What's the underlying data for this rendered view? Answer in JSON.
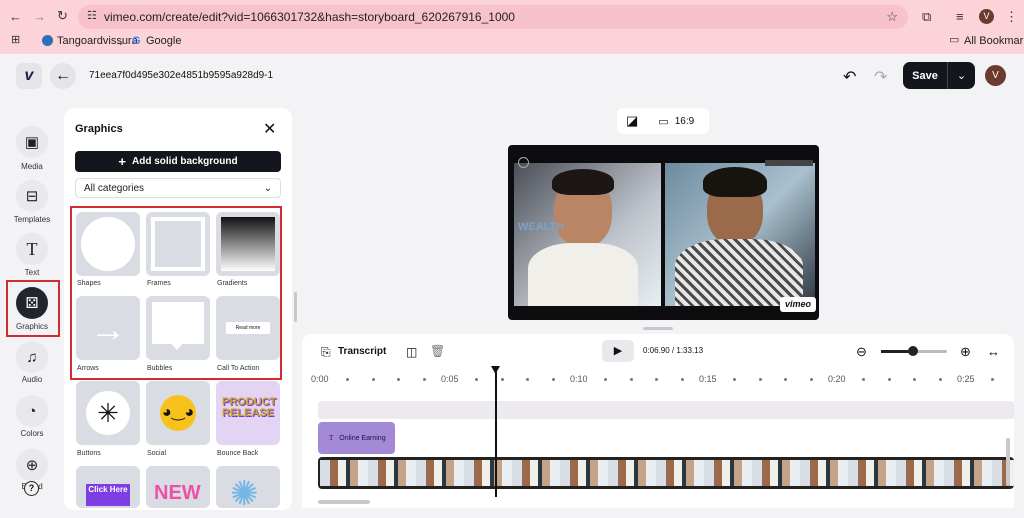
{
  "browser": {
    "url": "vimeo.com/create/edit?vid=1066301732&hash=storyboard_620267916_1000",
    "avatar_letter": "V",
    "bookmarks": [
      "Tangoardvissura",
      "Google"
    ],
    "all_bookmarks": "All Bookmarks"
  },
  "header": {
    "logo": "v",
    "project_id": "71eea7f0d495e302e4851b9595a928d9-1",
    "save_label": "Save",
    "user_initial": "V"
  },
  "sidebar": {
    "items": [
      {
        "label": "Media",
        "icon": "image-icon"
      },
      {
        "label": "Templates",
        "icon": "templates-icon"
      },
      {
        "label": "Text",
        "icon": "text-icon"
      },
      {
        "label": "Graphics",
        "icon": "graphics-icon",
        "active": true
      },
      {
        "label": "Audio",
        "icon": "music-icon"
      },
      {
        "label": "Colors",
        "icon": "palette-icon"
      },
      {
        "label": "Brand",
        "icon": "brand-icon"
      }
    ]
  },
  "graphics_panel": {
    "title": "Graphics",
    "add_bg": "Add solid background",
    "category": "All categories",
    "cards": [
      "Shapes",
      "Frames",
      "Gradients",
      "Arrows",
      "Bubbles",
      "Call To Action",
      "Buttons",
      "Social",
      "Bounce Back"
    ],
    "cta_text": "Read more",
    "bounce_text": "PRODUCT RELEASE",
    "bottom_cards": [
      "Click Here",
      "NEW"
    ]
  },
  "canvas": {
    "aspect": "16:9",
    "watermark": "vimeo",
    "video_tag": "WEALTH"
  },
  "timeline": {
    "transcript_label": "Transcript",
    "current_time": "0:06.90",
    "separator": " / ",
    "total_time": "1:33.13",
    "ticks": [
      "0:00",
      "0:05",
      "0:10",
      "0:15",
      "0:20",
      "0:25"
    ],
    "text_clip": "Online Earning"
  },
  "colors": {
    "chrome": "#fbd3d9",
    "accent_purple": "#a48ad6",
    "highlight_red": "#d22c33"
  }
}
